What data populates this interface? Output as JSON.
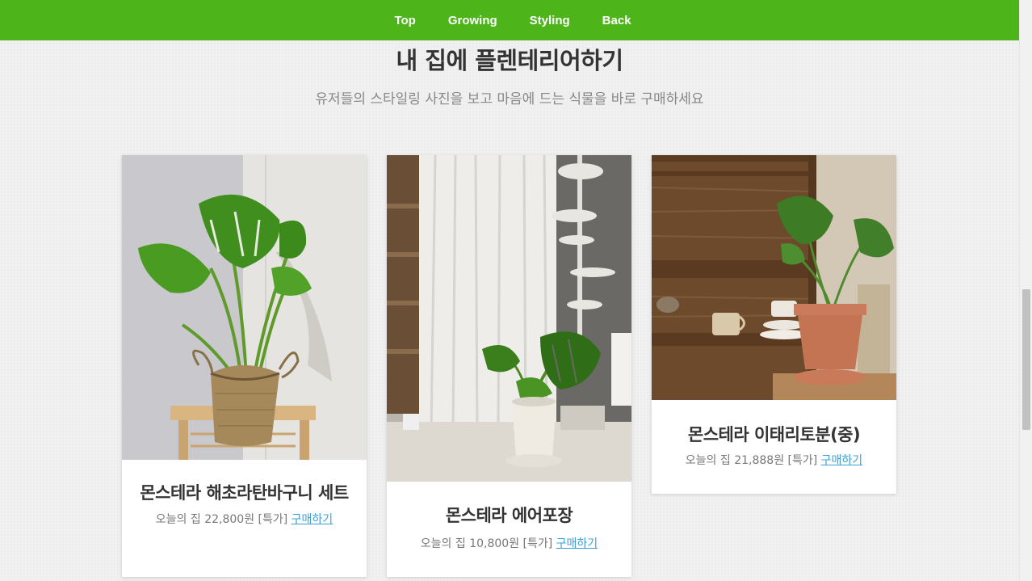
{
  "nav": {
    "items": [
      "Top",
      "Growing",
      "Styling",
      "Back"
    ]
  },
  "section": {
    "title": "내 집에 플렌테리어하기",
    "subtitle": "유저들의 스타일링 사진을 보고 마음에 드는 식물을 바로 구매하세요"
  },
  "cards": [
    {
      "title": "몬스테라 해초라탄바구니 세트",
      "meta": "오늘의 집 22,800원 [특가]",
      "buy": "구매하기"
    },
    {
      "title": "몬스테라 에어포장",
      "meta": "오늘의 집 10,800원 [특가]",
      "buy": "구매하기"
    },
    {
      "title": "몬스테라 이태리토분(중)",
      "meta": "오늘의 집 21,888원 [특가]",
      "buy": "구매하기"
    }
  ],
  "colors": {
    "nav_bg": "#4db41a",
    "link": "#3aa0d8"
  }
}
